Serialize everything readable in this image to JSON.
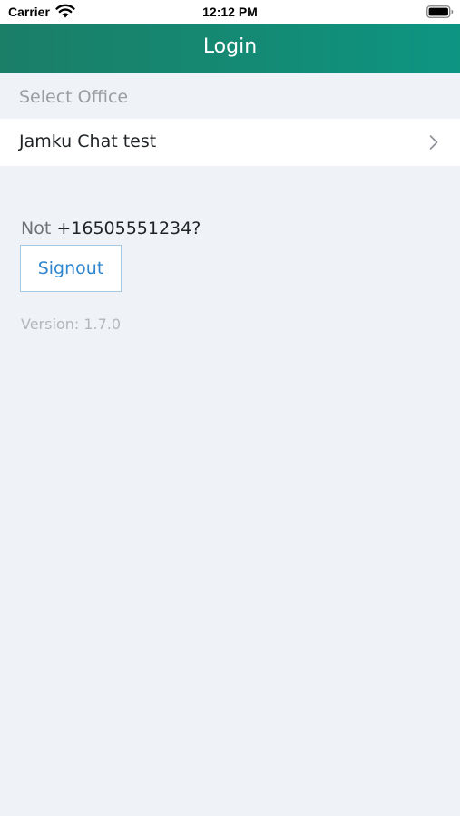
{
  "status_bar": {
    "carrier": "Carrier",
    "time": "12:12 PM"
  },
  "nav": {
    "title": "Login"
  },
  "office": {
    "section_label": "Select Office",
    "selected": "Jamku Chat test"
  },
  "account": {
    "not_word": "Not",
    "phone": "+16505551234?"
  },
  "signout": {
    "label": "Signout"
  },
  "version": {
    "text": "Version: 1.7.0"
  },
  "colors": {
    "header_start": "#1b7e67",
    "header_end": "#0d9582",
    "background": "#eff3f7",
    "link_blue": "#2f86cf"
  },
  "icons": {
    "status": [
      "wifi-icon",
      "battery-icon"
    ],
    "row": "chevron-right-icon"
  }
}
